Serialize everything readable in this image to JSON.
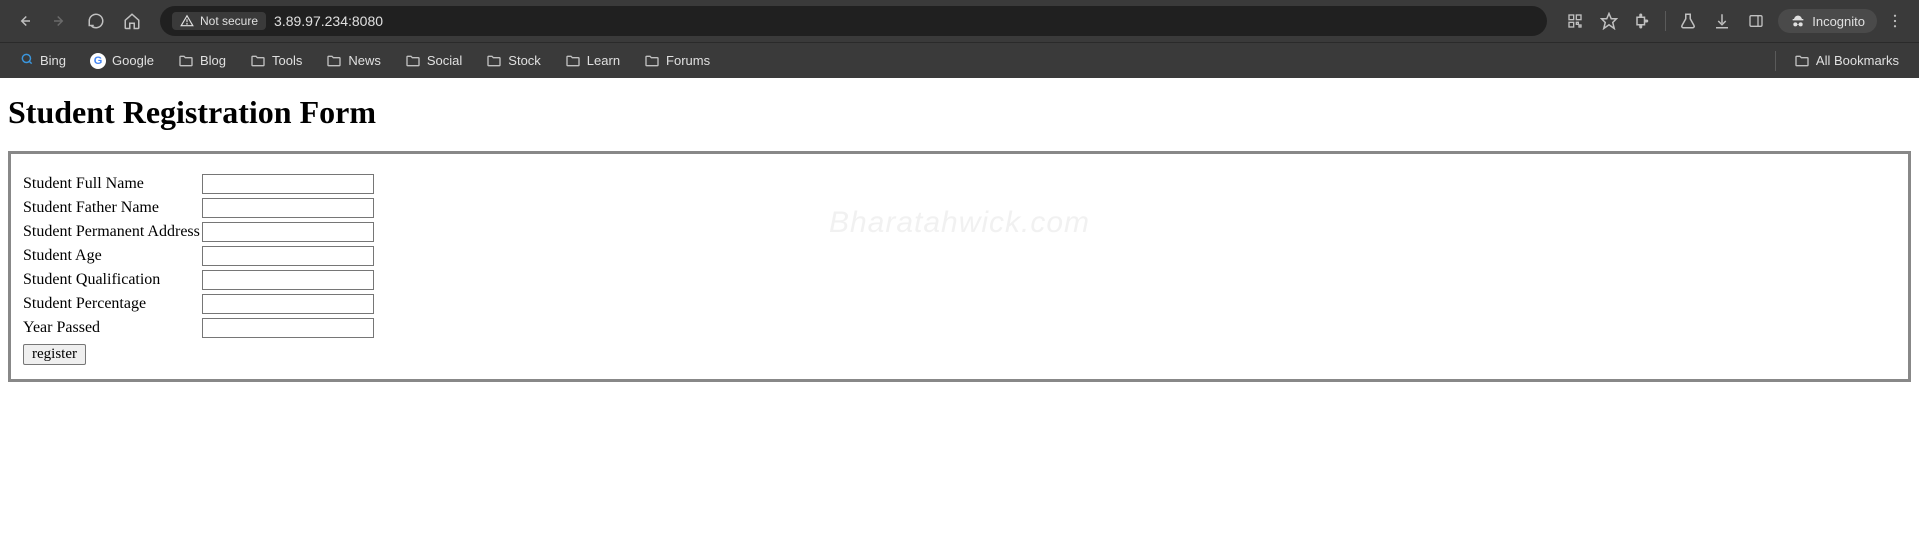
{
  "browser": {
    "security_label": "Not secure",
    "url": "3.89.97.234:8080",
    "incognito_label": "Incognito"
  },
  "bookmarks": {
    "items": [
      {
        "label": "Bing",
        "icon": "bing"
      },
      {
        "label": "Google",
        "icon": "google"
      },
      {
        "label": "Blog",
        "icon": "folder"
      },
      {
        "label": "Tools",
        "icon": "folder"
      },
      {
        "label": "News",
        "icon": "folder"
      },
      {
        "label": "Social",
        "icon": "folder"
      },
      {
        "label": "Stock",
        "icon": "folder"
      },
      {
        "label": "Learn",
        "icon": "folder"
      },
      {
        "label": "Forums",
        "icon": "folder"
      }
    ],
    "all_bookmarks_label": "All Bookmarks"
  },
  "page": {
    "title": "Student Registration Form",
    "watermark": "Bharatahwick.com",
    "fields": [
      {
        "label": "Student Full Name",
        "value": ""
      },
      {
        "label": "Student Father Name",
        "value": ""
      },
      {
        "label": "Student Permanent Address",
        "value": ""
      },
      {
        "label": "Student Age",
        "value": ""
      },
      {
        "label": "Student Qualification",
        "value": ""
      },
      {
        "label": "Student Percentage",
        "value": ""
      },
      {
        "label": "Year Passed",
        "value": ""
      }
    ],
    "submit_label": "register"
  }
}
